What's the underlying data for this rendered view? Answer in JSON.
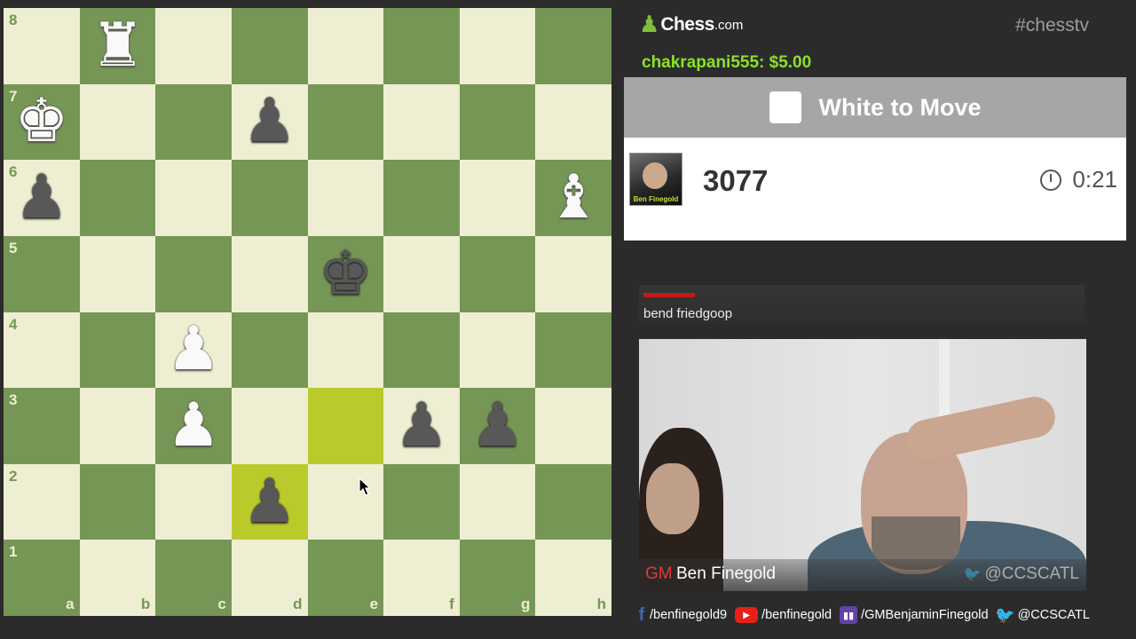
{
  "board": {
    "files": [
      "a",
      "b",
      "c",
      "d",
      "e",
      "f",
      "g",
      "h"
    ],
    "ranks": [
      "8",
      "7",
      "6",
      "5",
      "4",
      "3",
      "2",
      "1"
    ],
    "highlight_squares": [
      "e3",
      "d2"
    ],
    "pieces": [
      {
        "square": "b8",
        "color": "white",
        "type": "rook",
        "glyph": "♜"
      },
      {
        "square": "a7",
        "color": "white",
        "type": "king",
        "glyph": "♚"
      },
      {
        "square": "d7",
        "color": "black",
        "type": "pawn",
        "glyph": "♟"
      },
      {
        "square": "a6",
        "color": "black",
        "type": "pawn",
        "glyph": "♟"
      },
      {
        "square": "h6",
        "color": "white",
        "type": "bishop",
        "glyph": "♝"
      },
      {
        "square": "e5",
        "color": "black",
        "type": "king",
        "glyph": "♚"
      },
      {
        "square": "c4",
        "color": "white",
        "type": "pawn",
        "glyph": "♟"
      },
      {
        "square": "c3",
        "color": "white",
        "type": "pawn",
        "glyph": "♟"
      },
      {
        "square": "f3",
        "color": "black",
        "type": "pawn",
        "glyph": "♟"
      },
      {
        "square": "g3",
        "color": "black",
        "type": "pawn",
        "glyph": "♟"
      },
      {
        "square": "d2",
        "color": "black",
        "type": "pawn",
        "glyph": "♟"
      }
    ],
    "colors": {
      "light": "#eeeed2",
      "dark": "#769656",
      "highlight": "#baca2b"
    }
  },
  "header": {
    "logo_name": "Chess",
    "logo_tld": ".com",
    "logo_icon": "pawn-icon",
    "hashtag": "#chesstv"
  },
  "donation": "chakrapani555: $5.00",
  "to_move": "White to Move",
  "player": {
    "avatar_caption": "Ben Finegold",
    "rating": "3077",
    "time": "0:21",
    "timer_icon": "clock-icon"
  },
  "chat": {
    "message": "bend friedgoop"
  },
  "webcam": {
    "title_prefix": "GM",
    "name": "Ben Finegold",
    "handle": "@CCSCATL"
  },
  "socials": [
    {
      "icon": "facebook-icon",
      "icon_glyph": "f",
      "label": "/benfinegold9"
    },
    {
      "icon": "youtube-icon",
      "icon_glyph": "▶",
      "label": "/benfinegold"
    },
    {
      "icon": "twitch-icon",
      "icon_glyph": "▮▮",
      "label": "/GMBenjaminFinegold"
    },
    {
      "icon": "twitter-icon",
      "icon_glyph": "🐦",
      "label": "@CCSCATL"
    }
  ]
}
